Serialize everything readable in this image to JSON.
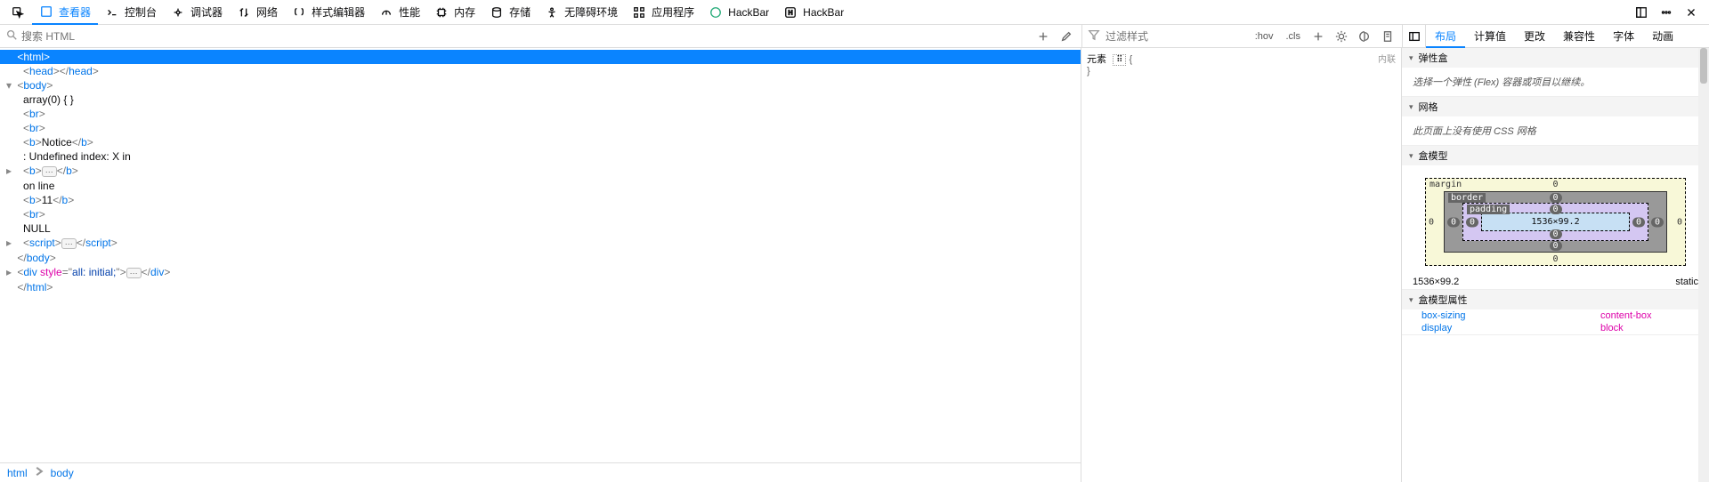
{
  "toolbar": {
    "tabs": [
      {
        "label": "查看器",
        "icon": "inspector",
        "active": true
      },
      {
        "label": "控制台",
        "icon": "console"
      },
      {
        "label": "调试器",
        "icon": "debugger"
      },
      {
        "label": "网络",
        "icon": "network"
      },
      {
        "label": "样式编辑器",
        "icon": "style"
      },
      {
        "label": "性能",
        "icon": "perf"
      },
      {
        "label": "内存",
        "icon": "memory"
      },
      {
        "label": "存储",
        "icon": "storage"
      },
      {
        "label": "无障碍环境",
        "icon": "a11y"
      },
      {
        "label": "应用程序",
        "icon": "app"
      },
      {
        "label": "HackBar",
        "icon": "hackbar1"
      },
      {
        "label": "HackBar",
        "icon": "hackbar2"
      }
    ]
  },
  "search": {
    "placeholder": "搜索 HTML"
  },
  "filter": {
    "placeholder": "过滤样式"
  },
  "style_btns": {
    "hov": ":hov",
    "cls": ".cls"
  },
  "right_tabs": [
    "布局",
    "计算值",
    "更改",
    "兼容性",
    "字体",
    "动画"
  ],
  "dom_lines": [
    {
      "indent": 1,
      "twisty": "",
      "sel": true,
      "parts": [
        {
          "t": "ang",
          "v": "<"
        },
        {
          "t": "tag",
          "v": "html"
        },
        {
          "t": "ang",
          "v": ">"
        }
      ]
    },
    {
      "indent": 2,
      "twisty": "",
      "parts": [
        {
          "t": "ang",
          "v": "<"
        },
        {
          "t": "tag",
          "v": "head"
        },
        {
          "t": "ang",
          "v": ">"
        },
        {
          "t": "ang",
          "v": "</"
        },
        {
          "t": "tag",
          "v": "head"
        },
        {
          "t": "ang",
          "v": ">"
        }
      ]
    },
    {
      "indent": 1,
      "twisty": "▾",
      "parts": [
        {
          "t": "ang",
          "v": "<"
        },
        {
          "t": "tag",
          "v": "body"
        },
        {
          "t": "ang",
          "v": ">"
        }
      ]
    },
    {
      "indent": 2,
      "twisty": "",
      "parts": [
        {
          "t": "txt",
          "v": "array(0) { }"
        }
      ]
    },
    {
      "indent": 2,
      "twisty": "",
      "parts": [
        {
          "t": "ang",
          "v": "<"
        },
        {
          "t": "tag",
          "v": "br"
        },
        {
          "t": "ang",
          "v": ">"
        }
      ]
    },
    {
      "indent": 2,
      "twisty": "",
      "parts": [
        {
          "t": "ang",
          "v": "<"
        },
        {
          "t": "tag",
          "v": "br"
        },
        {
          "t": "ang",
          "v": ">"
        }
      ]
    },
    {
      "indent": 2,
      "twisty": "",
      "parts": [
        {
          "t": "ang",
          "v": "<"
        },
        {
          "t": "tag",
          "v": "b"
        },
        {
          "t": "ang",
          "v": ">"
        },
        {
          "t": "txt",
          "v": "Notice"
        },
        {
          "t": "ang",
          "v": "</"
        },
        {
          "t": "tag",
          "v": "b"
        },
        {
          "t": "ang",
          "v": ">"
        }
      ]
    },
    {
      "indent": 2,
      "twisty": "",
      "parts": [
        {
          "t": "txt",
          "v": ": Undefined index: X in"
        }
      ]
    },
    {
      "indent": 2,
      "twisty": "▸",
      "parts": [
        {
          "t": "ang",
          "v": "<"
        },
        {
          "t": "tag",
          "v": "b"
        },
        {
          "t": "ang",
          "v": ">"
        },
        {
          "t": "ell",
          "v": "⋯"
        },
        {
          "t": "ang",
          "v": "</"
        },
        {
          "t": "tag",
          "v": "b"
        },
        {
          "t": "ang",
          "v": ">"
        }
      ]
    },
    {
      "indent": 2,
      "twisty": "",
      "parts": [
        {
          "t": "txt",
          "v": "on line"
        }
      ]
    },
    {
      "indent": 2,
      "twisty": "",
      "parts": [
        {
          "t": "ang",
          "v": "<"
        },
        {
          "t": "tag",
          "v": "b"
        },
        {
          "t": "ang",
          "v": ">"
        },
        {
          "t": "txt",
          "v": "11"
        },
        {
          "t": "ang",
          "v": "</"
        },
        {
          "t": "tag",
          "v": "b"
        },
        {
          "t": "ang",
          "v": ">"
        }
      ]
    },
    {
      "indent": 2,
      "twisty": "",
      "parts": [
        {
          "t": "ang",
          "v": "<"
        },
        {
          "t": "tag",
          "v": "br"
        },
        {
          "t": "ang",
          "v": ">"
        }
      ]
    },
    {
      "indent": 2,
      "twisty": "",
      "parts": [
        {
          "t": "txt",
          "v": "NULL"
        }
      ]
    },
    {
      "indent": 2,
      "twisty": "▸",
      "parts": [
        {
          "t": "ang",
          "v": "<"
        },
        {
          "t": "tag",
          "v": "script"
        },
        {
          "t": "ang",
          "v": ">"
        },
        {
          "t": "ell",
          "v": "⋯"
        },
        {
          "t": "ang",
          "v": "</"
        },
        {
          "t": "tag",
          "v": "script"
        },
        {
          "t": "ang",
          "v": ">"
        }
      ]
    },
    {
      "indent": 1,
      "twisty": "",
      "parts": [
        {
          "t": "ang",
          "v": "</"
        },
        {
          "t": "tag",
          "v": "body"
        },
        {
          "t": "ang",
          "v": ">"
        }
      ]
    },
    {
      "indent": 1,
      "twisty": "▸",
      "parts": [
        {
          "t": "ang",
          "v": "<"
        },
        {
          "t": "tag",
          "v": "div "
        },
        {
          "t": "attr",
          "v": "style"
        },
        {
          "t": "ang",
          "v": "=\""
        },
        {
          "t": "attrv",
          "v": "all: initial;"
        },
        {
          "t": "ang",
          "v": "\">"
        },
        {
          "t": "ell",
          "v": "⋯"
        },
        {
          "t": "ang",
          "v": "</"
        },
        {
          "t": "tag",
          "v": "div"
        },
        {
          "t": "ang",
          "v": ">"
        }
      ]
    },
    {
      "indent": 1,
      "twisty": "",
      "parts": [
        {
          "t": "ang",
          "v": "</"
        },
        {
          "t": "tag",
          "v": "html"
        },
        {
          "t": "ang",
          "v": ">"
        }
      ]
    }
  ],
  "breadcrumb": [
    "html",
    "body"
  ],
  "styles": {
    "selector": "元素",
    "dots": "",
    "inline_label": "内联"
  },
  "layout": {
    "flex": {
      "title": "弹性盒",
      "body": "选择一个弹性 (Flex) 容器或项目以继续。"
    },
    "grid": {
      "title": "网格",
      "body": "此页面上没有使用 CSS 网格"
    },
    "box": {
      "title": "盒模型",
      "margin_label": "margin",
      "border_label": "border",
      "padding_label": "padding",
      "content": "1536×99.2",
      "m": {
        "t": "0",
        "r": "0",
        "b": "0",
        "l": "0"
      },
      "b": {
        "t": "0",
        "r": "0",
        "b": "0",
        "l": "0"
      },
      "p": {
        "t": "0",
        "r": "0",
        "b": "0",
        "l": "0"
      },
      "summary_size": "1536×99.2",
      "summary_pos": "static",
      "props_title": "盒模型属性",
      "props": [
        {
          "k": "box-sizing",
          "v": "content-box"
        },
        {
          "k": "display",
          "v": "block"
        }
      ]
    }
  }
}
